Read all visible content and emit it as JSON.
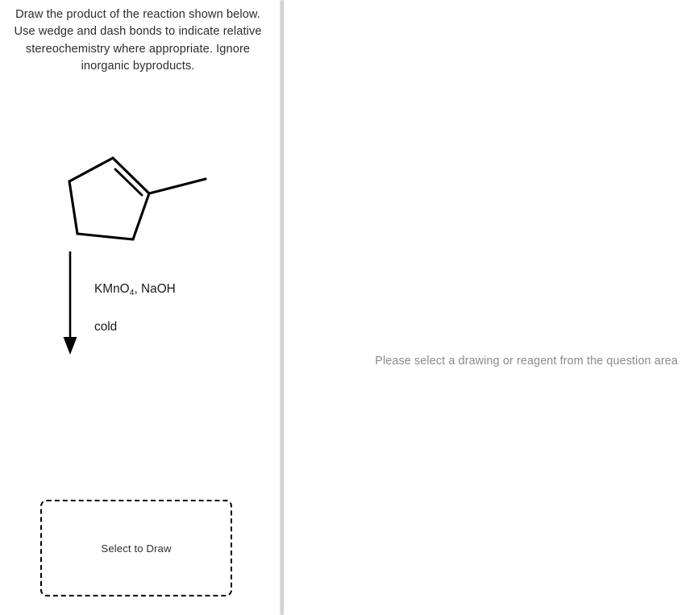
{
  "question": {
    "prompt": "Draw the product of the reaction shown below. Use wedge and dash bonds to indicate relative stereochemistry where appropriate. Ignore inorganic byproducts.",
    "reaction": {
      "reactant_name": "1-methylcyclopentene",
      "reagents_line_1_prefix": "KMnO",
      "reagents_line_1_subscript": "4",
      "reagents_line_1_suffix": ", NaOH",
      "reagents_line_1_full": "KMnO4, NaOH",
      "reagents_line_2": "cold",
      "arrow_direction": "down"
    },
    "answer_box": {
      "label": "Select to Draw",
      "state": "empty",
      "border_style": "dashed",
      "border_color": "#000000"
    }
  },
  "editor": {
    "placeholder": "Please select a drawing or reagent from the question area"
  },
  "colors": {
    "prompt_text": "#2d2d2d",
    "reagent_text": "#191919",
    "placeholder_text": "#8a8a8a",
    "bond_stroke": "#000000",
    "divider": "#d2d2d2",
    "background": "#ffffff"
  },
  "icons": {
    "reaction_arrow": "down-arrow-icon"
  }
}
